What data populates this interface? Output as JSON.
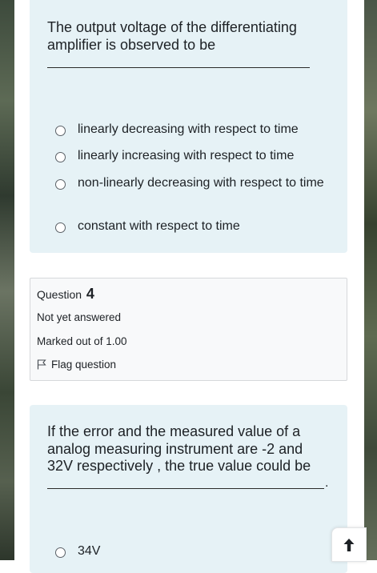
{
  "question3": {
    "text": "The output voltage of the differentiating amplifier is observed to be",
    "options": [
      {
        "label": "linearly decreasing with respect to time"
      },
      {
        "label": "linearly increasing with respect to time"
      },
      {
        "label": "non-linearly decreasing with respect to time"
      },
      {
        "label": "constant with respect to time"
      }
    ]
  },
  "question4": {
    "label": "Question",
    "number": "4",
    "state": "Not yet answered",
    "marks": "Marked out of 1.00",
    "flag_label": "Flag question",
    "text": "If the error and the measured value of a analog measuring instrument are -2 and 32V respectively , the true value could be",
    "trailing_dot": ".",
    "options": [
      {
        "label": "34V"
      }
    ]
  },
  "icons": {
    "flag": "flag-icon",
    "radio": "radio-icon",
    "scroll_top": "arrow-up-icon"
  }
}
